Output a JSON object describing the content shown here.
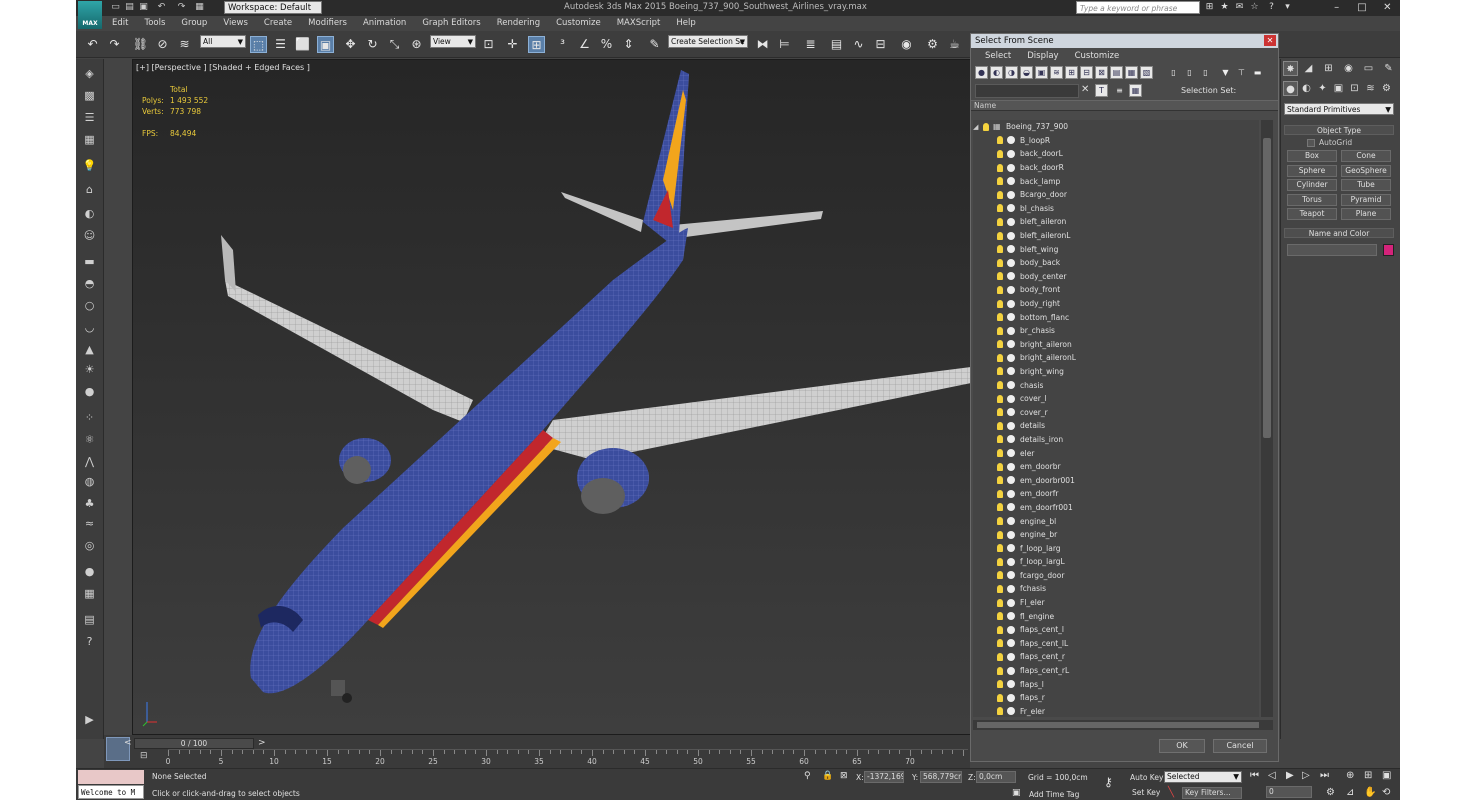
{
  "app": {
    "logo_text": "MAX",
    "window_title": "Autodesk 3ds Max  2015      Boeing_737_900_Southwest_Airlines_vray.max",
    "workspace": "Workspace: Default",
    "search_placeholder": "Type a keyword or phrase"
  },
  "menu": [
    "Edit",
    "Tools",
    "Group",
    "Views",
    "Create",
    "Modifiers",
    "Animation",
    "Graph Editors",
    "Rendering",
    "Customize",
    "MAXScript",
    "Help"
  ],
  "toolbar": {
    "selection_filter": "All",
    "ref_coord": "View",
    "named_sel_set": "Create Selection Se"
  },
  "viewport": {
    "label": "[+] [Perspective ] [Shaded + Edged Faces ]",
    "stats_header": "Total",
    "polys_label": "Polys:",
    "polys_value": "1 493 552",
    "verts_label": "Verts:",
    "verts_value": "773 798",
    "fps_label": "FPS:",
    "fps_value": "84,494",
    "colors": {
      "fuselage": "#3b4d9e",
      "accent": "#c1272d",
      "stripe": "#f2a51c",
      "wing": "#d3d3d3"
    }
  },
  "dialog": {
    "title": "Select From Scene",
    "menu": [
      "Select",
      "Display",
      "Customize"
    ],
    "selection_sets_label": "Selection Set:",
    "column_name": "Name",
    "root": "Boeing_737_900",
    "items": [
      "B_loopR",
      "back_doorL",
      "back_doorR",
      "back_lamp",
      "Bcargo_door",
      "bl_chasis",
      "bleft_aileron",
      "bleft_aileronL",
      "bleft_wing",
      "body_back",
      "body_center",
      "body_front",
      "body_right",
      "bottom_flanc",
      "br_chasis",
      "bright_aileron",
      "bright_aileronL",
      "bright_wing",
      "chasis",
      "cover_l",
      "cover_r",
      "details",
      "details_iron",
      "eler",
      "em_doorbr",
      "em_doorbr001",
      "em_doorfr",
      "em_doorfr001",
      "engine_bl",
      "engine_br",
      "f_loop_larg",
      "f_loop_largL",
      "fcargo_door",
      "fchasis",
      "Fl_eler",
      "fl_engine",
      "flaps_cent_l",
      "flaps_cent_lL",
      "flaps_cent_r",
      "flaps_cent_rL",
      "flaps_l",
      "flaps_r",
      "Fr_eler"
    ],
    "ok": "OK",
    "cancel": "Cancel"
  },
  "cmdpanel": {
    "dropdown": "Standard Primitives",
    "object_type": "Object Type",
    "autogrid": "AutoGrid",
    "buttons": [
      "Box",
      "Cone",
      "Sphere",
      "GeoSphere",
      "Cylinder",
      "Tube",
      "Torus",
      "Pyramid",
      "Teapot",
      "Plane"
    ],
    "name_color": "Name and Color",
    "swatch": "#d4237a"
  },
  "timeline": {
    "slider": "0 / 100",
    "ticks": [
      "0",
      "5",
      "10",
      "15",
      "20",
      "25",
      "30",
      "35",
      "40",
      "45",
      "50",
      "55",
      "60",
      "65",
      "70"
    ]
  },
  "status": {
    "maxscript": "Welcome to M",
    "selected": "None Selected",
    "prompt": "Click or click-and-drag to select objects",
    "x_label": "X:",
    "x_value": "-1372,169",
    "y_label": "Y:",
    "y_value": "568,779cm",
    "z_label": "Z:",
    "z_value": "0,0cm",
    "grid": "Grid = 100,0cm",
    "add_time_tag": "Add Time Tag",
    "auto_key": "Auto Key",
    "set_key": "Set Key",
    "key_mode": "Selected",
    "key_filters": "Key Filters...",
    "frame": "0"
  }
}
